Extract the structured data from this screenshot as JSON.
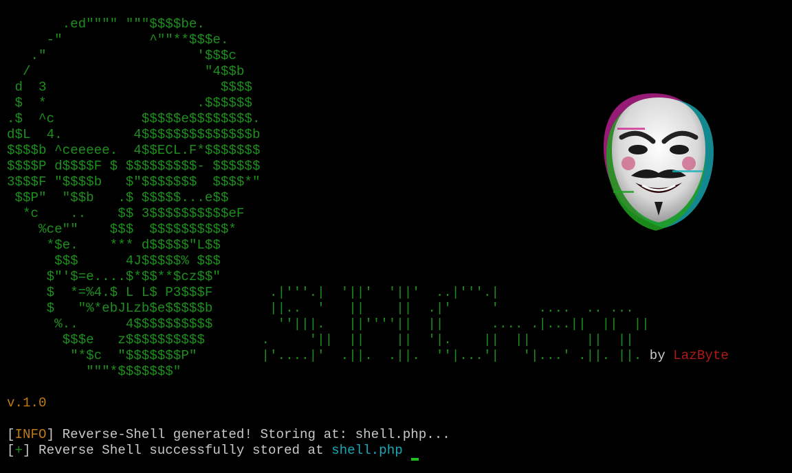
{
  "ascii_art_lines": [
    "       .ed\"\"\"\" \"\"\"$$$$be.",
    "     -\"           ^\"\"**$$$e.",
    "   .\"                   '$$$c",
    "  /                      \"4$$b",
    " d  3                      $$$$",
    " $  *                   .$$$$$$",
    ".$  ^c           $$$$$e$$$$$$$$.",
    "d$L  4.         4$$$$$$$$$$$$$$b",
    "$$$$b ^ceeeee.  4$$ECL.F*$$$$$$$",
    "$$$$P d$$$$F $ $$$$$$$$$- $$$$$$",
    "3$$$F \"$$$$b   $\"$$$$$$$  $$$$*\"",
    " $$P\"  \"$$b   .$ $$$$$...e$$",
    "  *c    ..    $$ 3$$$$$$$$$$eF",
    "    %ce\"\"    $$$  $$$$$$$$$$*",
    "     *$e.    *** d$$$$$\"L$$",
    "      $$$      4J$$$$$% $$$",
    "     $\"'$=e....$*$$**$cz$$\"",
    "     $  *=%4.$ L L$ P3$$$F",
    "     $   \"%*ebJLzb$e$$$$$b",
    "      %..      4$$$$$$$$$$",
    "       $$$e   z$$$$$$$$$$",
    "        \"*$c  \"$$$$$$$P\"",
    "          \"\"\"*$$$$$$$\""
  ],
  "banner_lines": [
    "    .|'''.|  '||'  '||'  ..|'''.|",
    "    ||..  '   ||    ||  .|'     '     ....  .. ...",
    "     ''|||.   ||''''||  ||      .... .|...||  ||  ||",
    "   .     '||  ||    ||  '|.    ||  ||       ||  ||",
    "   |'....|'  .||.  .||.  ''|...'|   '|...' .||. ||."
  ],
  "credit": {
    "by": "by",
    "author": "LazByte"
  },
  "version": "v.1.0",
  "log": [
    {
      "open": "[",
      "tag": "INFO",
      "close": "]",
      "message": " Reverse-Shell generated! Storing at: shell.php..."
    },
    {
      "open": "[",
      "tag": "+",
      "close": "]",
      "message": " Reverse Shell successfully stored at ",
      "path": "shell.php"
    }
  ],
  "mask_icon": "fsociety-mask-icon",
  "colors": {
    "background": "#000000",
    "ascii_green": "#1e8f1e",
    "text": "#c8c8c8",
    "author_red": "#b21818",
    "version_orange": "#c07a14",
    "path_cyan": "#18a8b8",
    "cursor_green": "#20c020"
  }
}
